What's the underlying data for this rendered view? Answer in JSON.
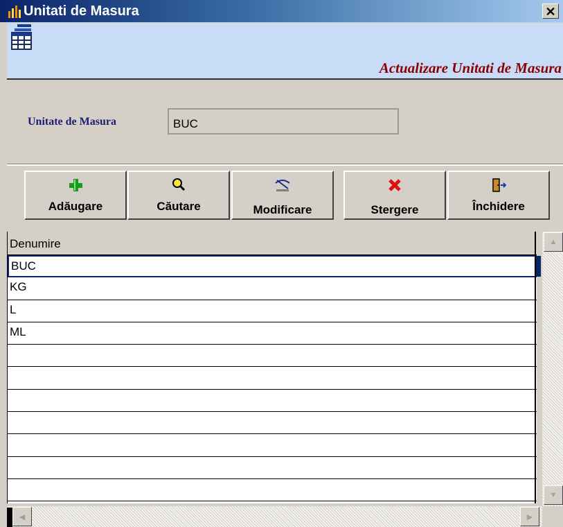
{
  "window": {
    "title": "Unitati de Masura",
    "close_label": "✕"
  },
  "header": {
    "title": "Actualizare Unitati de Masura"
  },
  "form": {
    "label": "Unitate de Masura",
    "value": "BUC"
  },
  "toolbar": {
    "add_label": "Adăugare",
    "search_label": "Căutare",
    "modify_label": "Modificare",
    "delete_label": "Stergere",
    "close_label": "Închidere"
  },
  "grid": {
    "column_header": "Denumire",
    "rows": [
      "BUC",
      "KG",
      "L",
      "ML",
      "",
      "",
      "",
      "",
      "",
      "",
      ""
    ],
    "selected_index": 0
  },
  "colors": {
    "title_bar": "#0a246a",
    "header_bg": "#c8dcf8",
    "header_title": "#8b0000"
  }
}
